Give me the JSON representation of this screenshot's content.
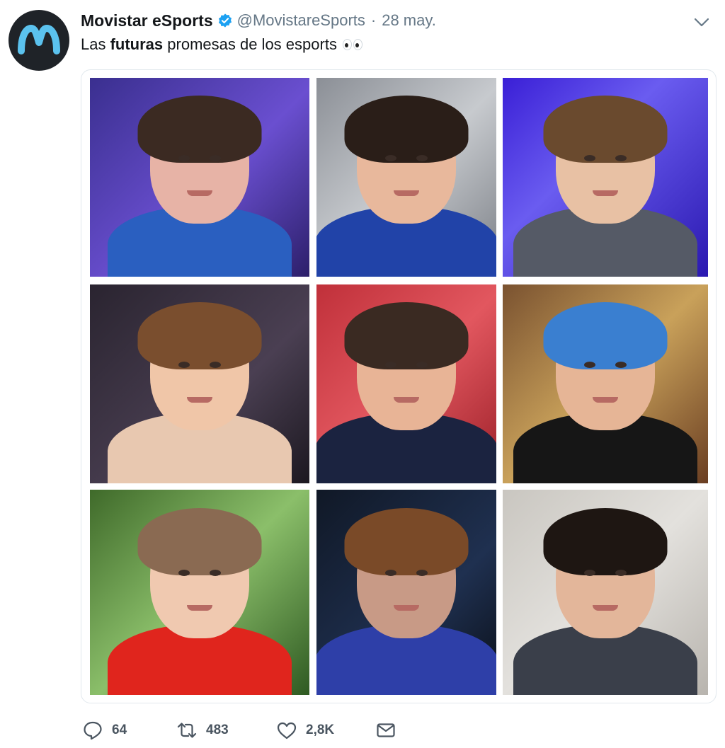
{
  "tweet": {
    "display_name": "Movistar eSports",
    "handle": "@MovistareSports",
    "separator": "·",
    "date": "28 may.",
    "text_before": "Las ",
    "text_bold": "futuras",
    "text_after": " promesas de los esports",
    "emoji": "eyes-emoji"
  },
  "media": {
    "photo_count": 9
  },
  "actions": {
    "reply_count": "64",
    "retweet_count": "483",
    "like_count": "2,8K"
  },
  "colors": {
    "avatar_bg": "#1f2328",
    "brand_blue": "#1da1f2",
    "movistar_logo": "#5bc2ee",
    "text_primary": "#14171a",
    "text_secondary": "#657786",
    "border": "#e1e8ed"
  },
  "icons": [
    "verified-badge-icon",
    "chevron-down-icon",
    "reply-icon",
    "retweet-icon",
    "like-icon",
    "direct-message-icon"
  ]
}
